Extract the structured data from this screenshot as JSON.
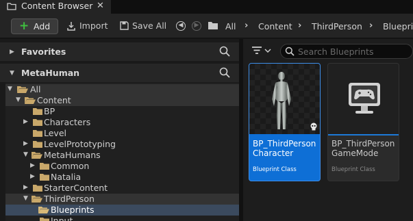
{
  "tab": {
    "title": "Content Browser",
    "close": "✕"
  },
  "toolbar": {
    "add_label": "Add",
    "import_label": "Import",
    "save_all_label": "Save All",
    "breadcrumb": [
      "All",
      "Content",
      "ThirdPerson",
      "Blueprints"
    ]
  },
  "left_panel": {
    "favorites_title": "Favorites",
    "project_title": "MetaHuman",
    "tree": [
      {
        "label": "All",
        "expanded": true,
        "state": "hl"
      },
      {
        "label": "Content",
        "expanded": true,
        "state": "hl"
      },
      {
        "label": "BP",
        "expanded": false,
        "state": ""
      },
      {
        "label": "Characters",
        "expanded": false,
        "state": ""
      },
      {
        "label": "Level",
        "expanded": false,
        "state": ""
      },
      {
        "label": "LevelPrototyping",
        "expanded": false,
        "state": ""
      },
      {
        "label": "MetaHumans",
        "expanded": true,
        "state": ""
      },
      {
        "label": "Common",
        "expanded": false,
        "state": ""
      },
      {
        "label": "Natalia",
        "expanded": false,
        "state": ""
      },
      {
        "label": "StarterContent",
        "expanded": false,
        "state": ""
      },
      {
        "label": "ThirdPerson",
        "expanded": true,
        "state": "hl"
      },
      {
        "label": "Blueprints",
        "expanded": false,
        "state": "sel"
      },
      {
        "label": "Input",
        "expanded": false,
        "state": ""
      }
    ]
  },
  "search": {
    "placeholder": "Search Blueprints",
    "value": ""
  },
  "assets": [
    {
      "name": "BP_ThirdPerson Character",
      "class": "Blueprint Class",
      "selected": true,
      "icon": "character-thumbnail"
    },
    {
      "name": "BP_ThirdPerson GameMode",
      "class": "Blueprint Class",
      "selected": false,
      "icon": "gamepad-monitor-icon"
    }
  ],
  "colors": {
    "selection_blue": "#0e6fd6",
    "add_green": "#3fbf3f",
    "folder": "#c9a86a"
  }
}
